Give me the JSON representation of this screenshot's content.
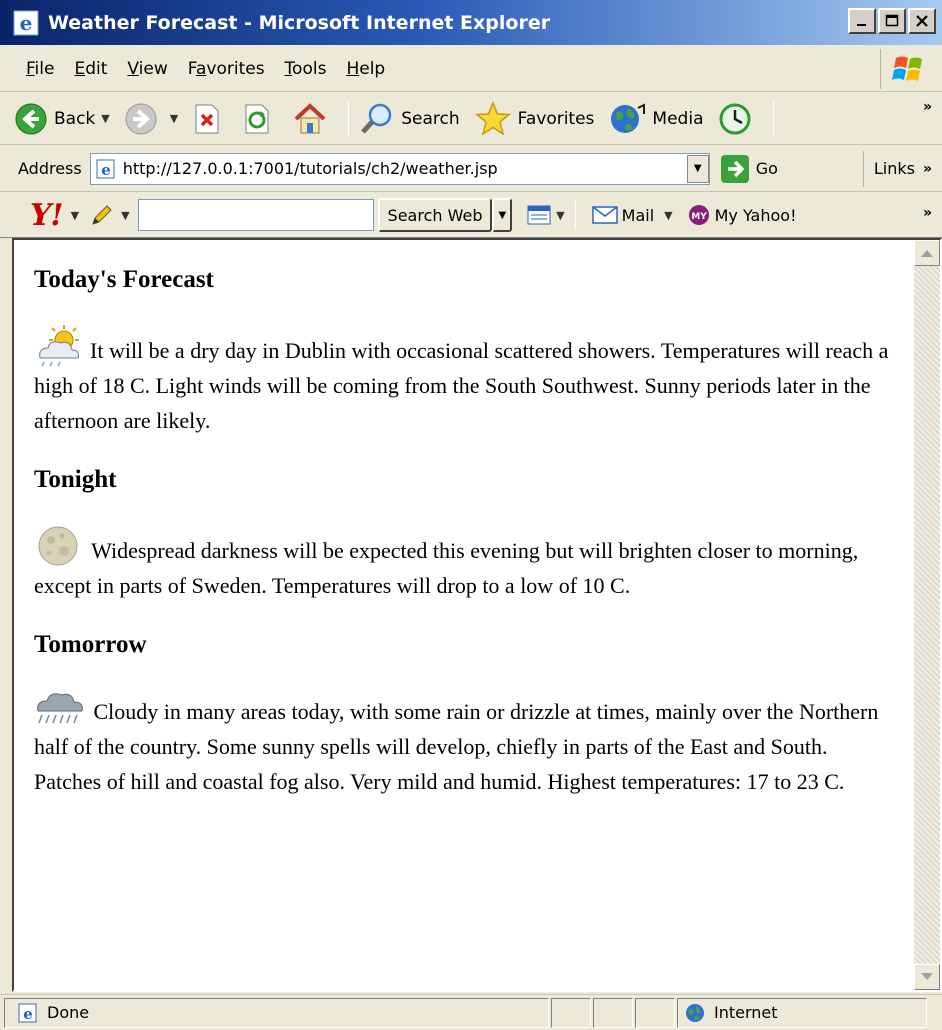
{
  "window": {
    "title": "Weather Forecast - Microsoft Internet Explorer"
  },
  "menu": {
    "items": [
      {
        "label": "File",
        "underline": "F",
        "rest": "ile"
      },
      {
        "label": "Edit",
        "underline": "E",
        "rest": "dit"
      },
      {
        "label": "View",
        "underline": "V",
        "rest": "iew"
      },
      {
        "label": "Favorites",
        "pre": "F",
        "underline": "a",
        "rest": "vorites"
      },
      {
        "label": "Tools",
        "underline": "T",
        "rest": "ools"
      },
      {
        "label": "Help",
        "underline": "H",
        "rest": "elp"
      }
    ]
  },
  "toolbar": {
    "back_label": "Back",
    "search_label": "Search",
    "favorites_label": "Favorites",
    "media_label": "Media"
  },
  "address": {
    "label": "Address",
    "url": "http://127.0.0.1:7001/tutorials/ch2/weather.jsp",
    "go_label": "Go",
    "links_label": "Links"
  },
  "yahoo": {
    "logo": "Y!",
    "search_button": "Search Web",
    "mail_label": "Mail",
    "myyahoo_label": "My Yahoo!"
  },
  "page": {
    "sections": [
      {
        "heading": "Today's Forecast",
        "icon": "sun-cloud-icon",
        "text": "It will be a dry day in Dublin with occasional scattered showers. Temperatures will reach a high of 18 C. Light winds will be coming from the South Southwest. Sunny periods later in the afternoon are likely."
      },
      {
        "heading": "Tonight",
        "icon": "moon-icon",
        "text": " Widespread darkness will be expected this evening but will brighten closer to morning, except in parts of Sweden. Temperatures will drop to a low of 10 C."
      },
      {
        "heading": "Tomorrow",
        "icon": "rain-cloud-icon",
        "text": " Cloudy in many areas today, with some rain or drizzle at times, mainly over the Northern half of the country. Some sunny spells will develop, chiefly in parts of the East and South. Patches of hill and coastal fog also. Very mild and humid. Highest temperatures: 17 to 23 C."
      }
    ]
  },
  "status": {
    "text": "Done",
    "zone": "Internet"
  }
}
